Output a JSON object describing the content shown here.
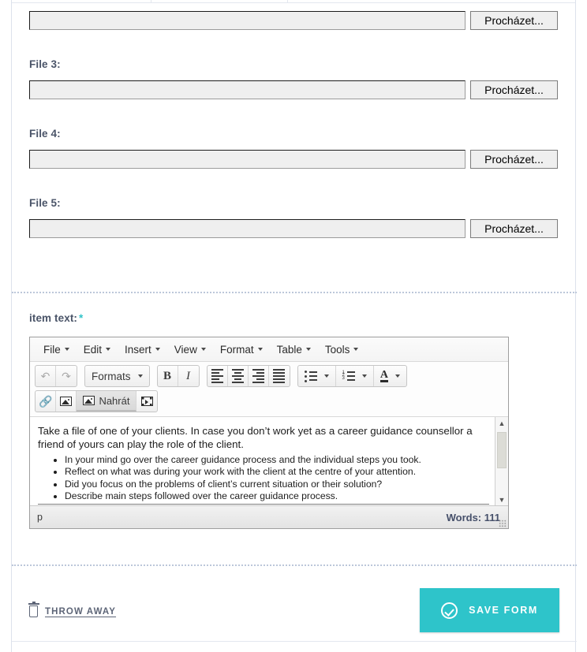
{
  "files_section": {
    "rows": [
      {
        "label": "",
        "input_value": "",
        "browse_label": "Procházet..."
      },
      {
        "label": "File 3:",
        "input_value": "",
        "browse_label": "Procházet..."
      },
      {
        "label": "File 4:",
        "input_value": "",
        "browse_label": "Procházet..."
      },
      {
        "label": "File 5:",
        "input_value": "",
        "browse_label": "Procházet..."
      }
    ]
  },
  "editor_section": {
    "label": "item text:",
    "required_marker": "*",
    "menubar": [
      {
        "label": "File"
      },
      {
        "label": "Edit"
      },
      {
        "label": "Insert"
      },
      {
        "label": "View"
      },
      {
        "label": "Format"
      },
      {
        "label": "Table"
      },
      {
        "label": "Tools"
      }
    ],
    "toolbar_row1": {
      "undo": "undo-icon",
      "redo": "redo-icon",
      "formats_label": "Formats",
      "bold": "B",
      "italic": "I",
      "align_left": "align-left-icon",
      "align_center": "align-center-icon",
      "align_right": "align-right-icon",
      "align_justify": "align-justify-icon",
      "bullet_list": "bullet-list-icon",
      "numbered_list": "numbered-list-icon",
      "text_color": "A"
    },
    "toolbar_row2": {
      "link": "link-icon",
      "image": "image-icon",
      "upload_label": "Nahrát",
      "media": "media-icon"
    },
    "content": {
      "paragraph": "Take a file of one of your clients. In case you don’t work yet as a career guidance counsellor a friend of yours can play the role of the client.",
      "bullets": [
        "In your mind go over the career guidance process and the individual steps you took.",
        "Reflect on what was during your work with the client at the centre of your attention.",
        "Did you focus on the problems of client’s current situation or their solution?",
        "Describe main steps followed over the career guidance process."
      ]
    },
    "statusbar": {
      "element_path": "p",
      "word_count": "Words: 111"
    }
  },
  "actions": {
    "throw_away_label": "THROW AWAY",
    "save_label": "SAVE FORM"
  },
  "colors": {
    "accent": "#2ec4ca",
    "label_text": "#4a5468",
    "divider": "#bcc7da",
    "muted_text": "#5d6577"
  }
}
